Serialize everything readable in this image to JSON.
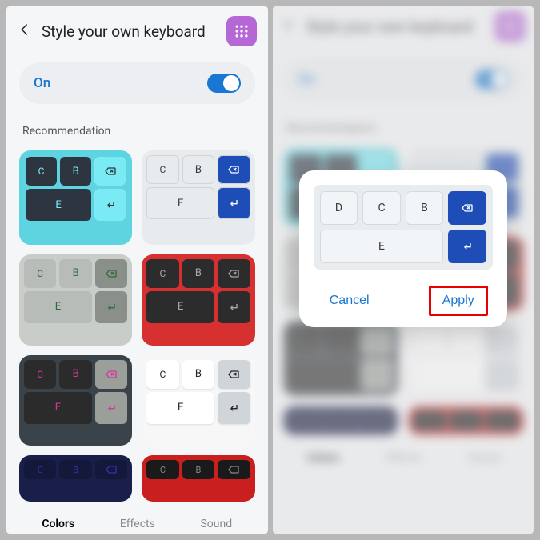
{
  "header": {
    "title": "Style your own keyboard"
  },
  "toggle": {
    "label": "On",
    "state": true
  },
  "section": {
    "recommendation": "Recommendation"
  },
  "keys": {
    "b": "B",
    "c": "C",
    "d": "D",
    "e": "E"
  },
  "tabs": {
    "colors": "Colors",
    "effects": "Effects",
    "sound": "Sound"
  },
  "dialog": {
    "cancel": "Cancel",
    "apply": "Apply"
  },
  "themes": [
    {
      "id": "cyan"
    },
    {
      "id": "blue"
    },
    {
      "id": "gray"
    },
    {
      "id": "red"
    },
    {
      "id": "pink"
    },
    {
      "id": "white"
    },
    {
      "id": "navy"
    },
    {
      "id": "redark"
    }
  ]
}
